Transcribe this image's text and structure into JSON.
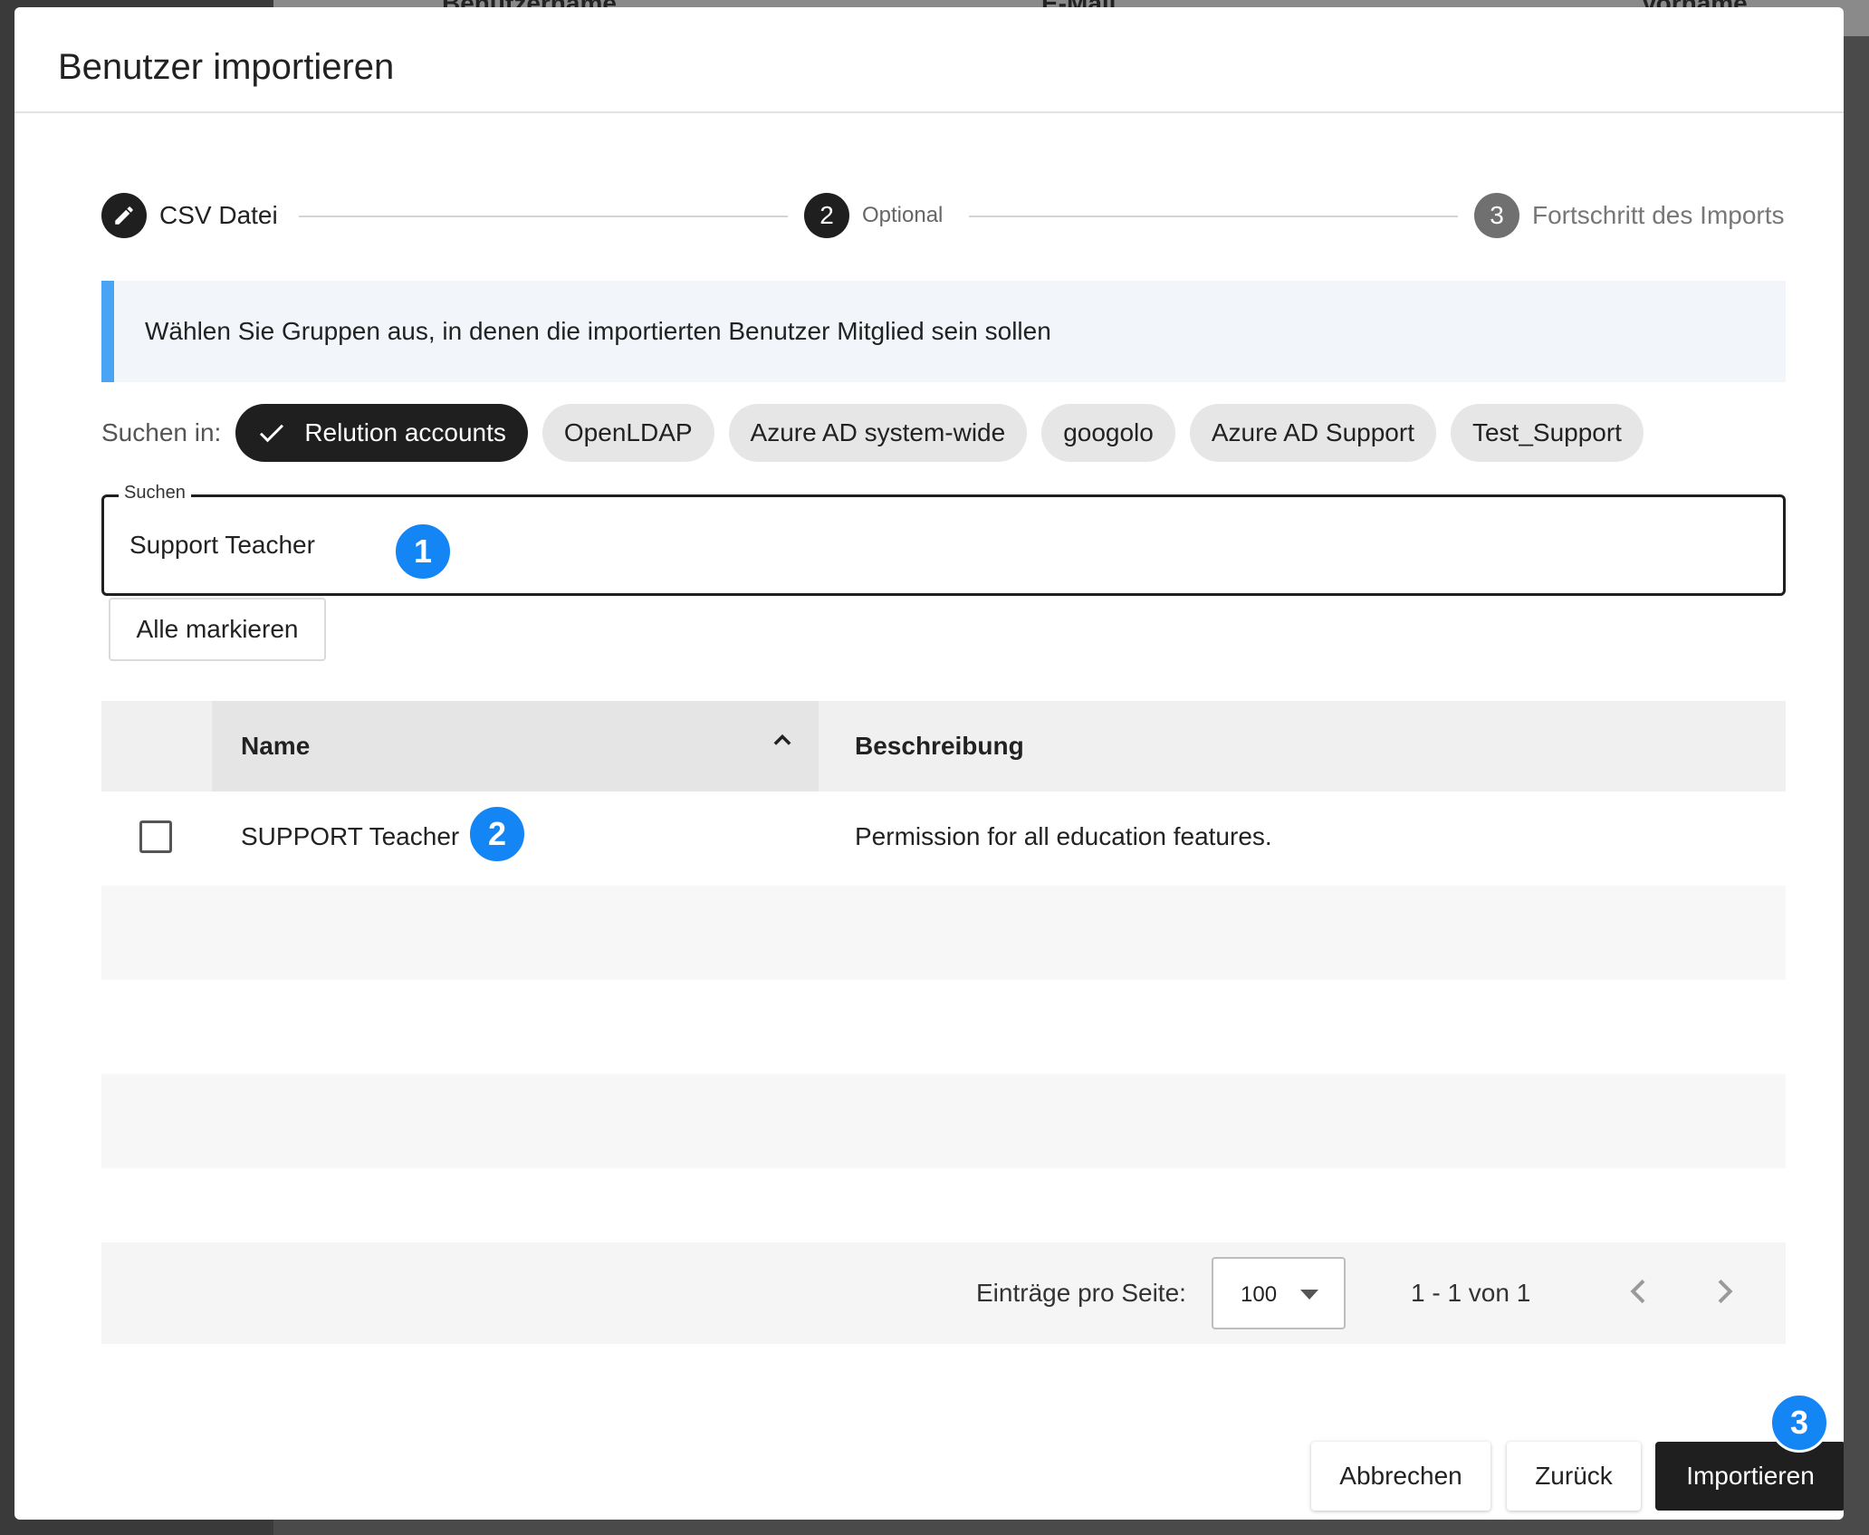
{
  "background": {
    "columns": [
      "Benutzername",
      "E-Mail",
      "Vorname"
    ]
  },
  "dialog": {
    "title": "Benutzer importieren"
  },
  "stepper": {
    "steps": [
      {
        "number": "1",
        "label": "CSV Datei",
        "state": "edit",
        "icon": "pencil-icon"
      },
      {
        "number": "2",
        "label": "Optional",
        "state": "active"
      },
      {
        "number": "3",
        "label": "Fortschritt des Imports",
        "state": "pending"
      }
    ]
  },
  "info_banner": {
    "text": "Wählen Sie Gruppen aus, in denen die importierten Benutzer Mitglied sein sollen"
  },
  "sources": {
    "label": "Suchen in:",
    "chips": [
      {
        "label": "Relution accounts",
        "selected": true
      },
      {
        "label": "OpenLDAP",
        "selected": false
      },
      {
        "label": "Azure AD system-wide",
        "selected": false
      },
      {
        "label": "googolo",
        "selected": false
      },
      {
        "label": "Azure AD Support",
        "selected": false
      },
      {
        "label": "Test_Support",
        "selected": false
      }
    ]
  },
  "search": {
    "label": "Suchen",
    "value": "Support Teacher"
  },
  "select_all": {
    "label": "Alle markieren"
  },
  "table": {
    "columns": {
      "name": "Name",
      "description": "Beschreibung"
    },
    "sort": "ascending",
    "rows": [
      {
        "name": "SUPPORT Teacher",
        "description": "Permission for all education features.",
        "checked": false
      }
    ]
  },
  "pagination": {
    "per_page_label": "Einträge pro Seite:",
    "per_page_value": "100",
    "range": "1 - 1 von 1"
  },
  "footer": {
    "cancel": "Abbrechen",
    "back": "Zurück",
    "import": "Importieren"
  },
  "annotations": [
    "1",
    "2",
    "3"
  ],
  "colors": {
    "accent": "#1485f5",
    "info_bar": "#4aa4f5",
    "dark": "#1f1f1f",
    "step_pending": "#707070"
  }
}
